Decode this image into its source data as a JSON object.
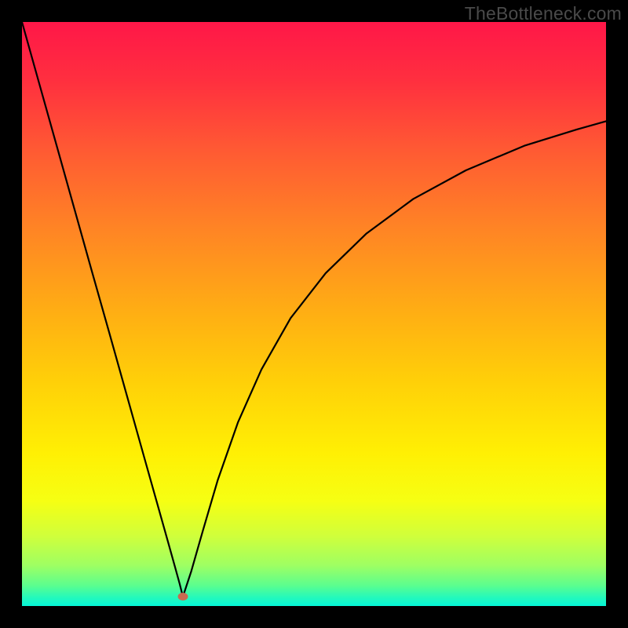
{
  "watermark": "TheBottleneck.com",
  "gradient": {
    "stops": [
      {
        "offset": 0.0,
        "color": "#ff1748"
      },
      {
        "offset": 0.1,
        "color": "#ff2f3f"
      },
      {
        "offset": 0.22,
        "color": "#ff5a33"
      },
      {
        "offset": 0.35,
        "color": "#ff8325"
      },
      {
        "offset": 0.5,
        "color": "#ffaf13"
      },
      {
        "offset": 0.62,
        "color": "#ffd108"
      },
      {
        "offset": 0.74,
        "color": "#fff004"
      },
      {
        "offset": 0.82,
        "color": "#f6ff13"
      },
      {
        "offset": 0.88,
        "color": "#d0ff3b"
      },
      {
        "offset": 0.93,
        "color": "#9fff62"
      },
      {
        "offset": 0.965,
        "color": "#5bfe8f"
      },
      {
        "offset": 0.985,
        "color": "#25f9bb"
      },
      {
        "offset": 1.0,
        "color": "#05f6d8"
      }
    ]
  },
  "marker": {
    "x_frac": 0.2755,
    "y_frac": 0.984
  },
  "chart_data": {
    "type": "line",
    "title": "",
    "xlabel": "",
    "ylabel": "",
    "xlim": [
      0,
      1
    ],
    "ylim": [
      0,
      1
    ],
    "series": [
      {
        "name": "left-branch",
        "x": [
          0.0,
          0.03,
          0.06,
          0.09,
          0.12,
          0.15,
          0.18,
          0.21,
          0.23,
          0.25,
          0.262,
          0.27,
          0.2755
        ],
        "y": [
          1.0,
          0.893,
          0.786,
          0.679,
          0.572,
          0.466,
          0.359,
          0.252,
          0.181,
          0.11,
          0.067,
          0.038,
          0.016
        ]
      },
      {
        "name": "right-branch",
        "x": [
          0.2755,
          0.29,
          0.31,
          0.335,
          0.37,
          0.41,
          0.46,
          0.52,
          0.59,
          0.67,
          0.76,
          0.86,
          0.95,
          1.0
        ],
        "y": [
          0.016,
          0.06,
          0.13,
          0.215,
          0.315,
          0.405,
          0.493,
          0.57,
          0.638,
          0.697,
          0.746,
          0.788,
          0.816,
          0.83
        ]
      }
    ],
    "marker_point": {
      "x": 0.2755,
      "y": 0.016
    },
    "notes": "x and y are normalized fractions of the 744x744 plot area (0 = left/bottom, 1 = right/top). No axis ticks or numeric labels are visible in the source image — values are geometric estimates from pixel positions."
  }
}
